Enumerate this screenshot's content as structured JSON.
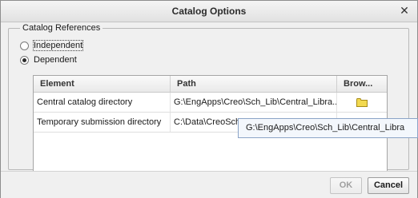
{
  "window": {
    "title": "Catalog Options",
    "close_glyph": "✕"
  },
  "group": {
    "legend": "Catalog References",
    "radios": [
      {
        "label": "Independent",
        "checked": false
      },
      {
        "label": "Dependent",
        "checked": true
      }
    ]
  },
  "table": {
    "columns": [
      "Element",
      "Path",
      "Brow..."
    ],
    "rows": [
      {
        "element": "Central catalog directory",
        "path": "G:\\EngApps\\Creo\\Sch_Lib\\Central_Libra...",
        "browse_icon": "folder-icon"
      },
      {
        "element": "Temporary submission directory",
        "path": "C:\\Data\\CreoSche...",
        "browse_icon": "folder-icon"
      }
    ]
  },
  "tooltip": {
    "text": "G:\\EngApps\\Creo\\Sch_Lib\\Central_Libra"
  },
  "buttons": {
    "ok": "OK",
    "cancel": "Cancel"
  },
  "colors": {
    "folder_fill": "#f2d94f",
    "folder_stroke": "#a78b18",
    "tooltip_border": "#8ba4c7"
  }
}
